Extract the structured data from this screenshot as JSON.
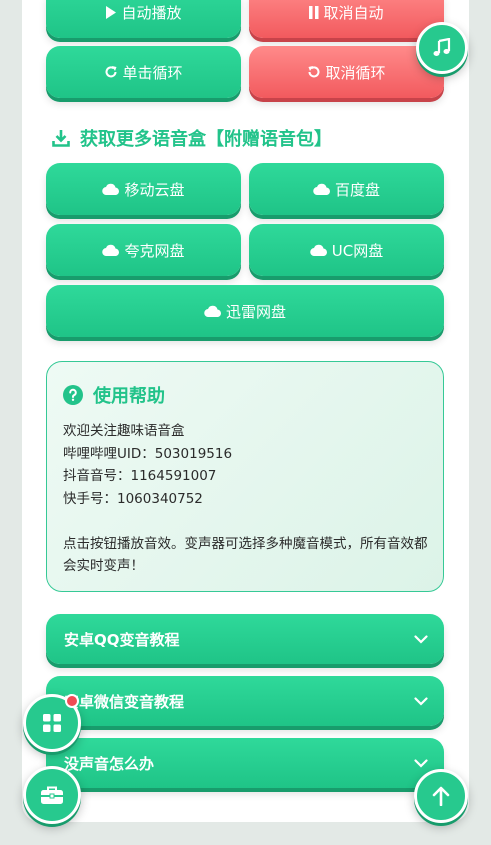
{
  "controls": {
    "auto_play": "自动播放",
    "cancel_auto": "取消自动",
    "single_loop": "单击循环",
    "cancel_loop": "取消循环"
  },
  "download_section": {
    "title": "获取更多语音盒【附赠语音包】",
    "links": [
      "移动云盘",
      "百度盘",
      "夸克网盘",
      "UC网盘",
      "迅雷网盘"
    ]
  },
  "help": {
    "title": "使用帮助",
    "lines": [
      "欢迎关注趣味语音盒",
      "哔哩哔哩UID：503019516",
      "抖音音号：1164591007",
      "快手号：1060340752",
      "",
      "点击按钮播放音效。变声器可选择多种魔音模式，所有音效都会实时变声！"
    ]
  },
  "faq": [
    "安卓QQ变音教程",
    "安卓微信变音教程",
    "没声音怎么办"
  ],
  "colors": {
    "accent": "#22c38a",
    "danger": "#f25a5e",
    "badge": "#f04c55"
  },
  "icons": {
    "play": "play-icon",
    "pause": "pause-icon",
    "redo": "redo-icon",
    "undo": "undo-icon",
    "download": "download-icon",
    "cloud": "cloud-icon",
    "help": "question-circle-icon",
    "chevron": "chevron-down-icon",
    "music": "music-note-icon",
    "grid": "grid-icon",
    "toolbox": "toolbox-icon",
    "arrow_up": "arrow-up-icon"
  }
}
